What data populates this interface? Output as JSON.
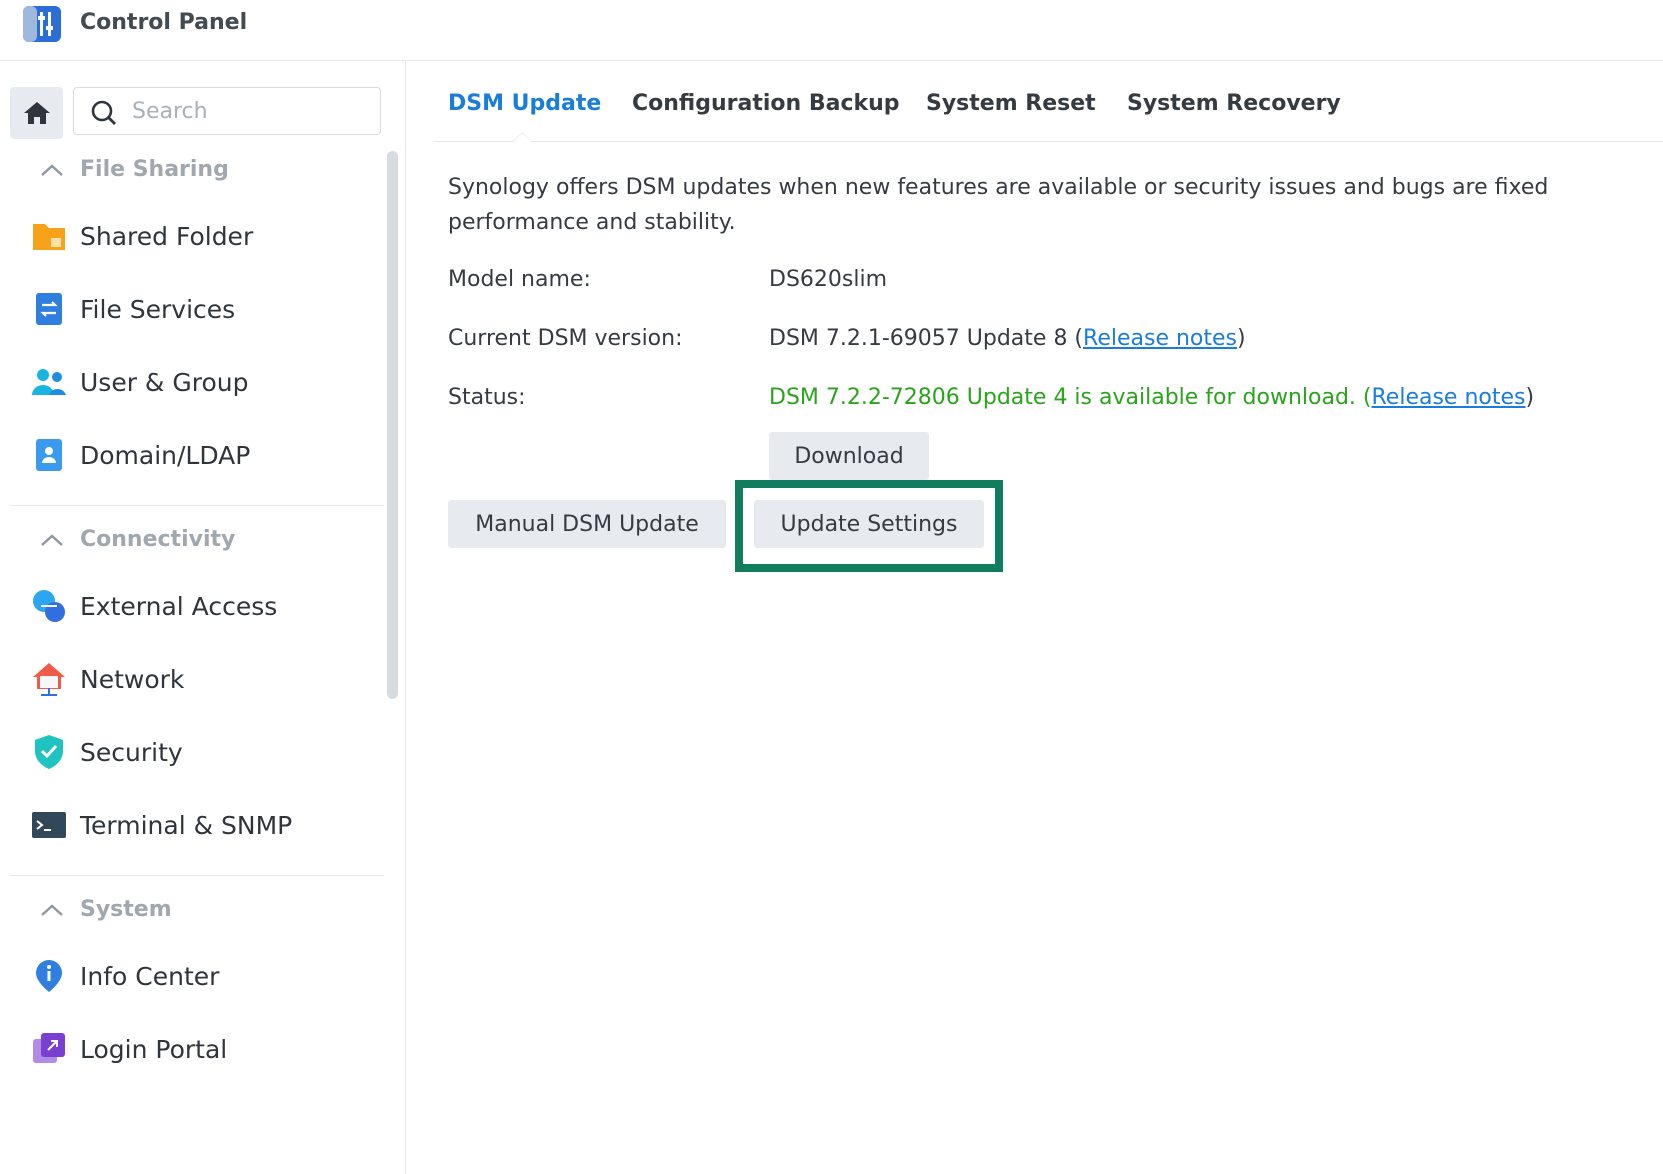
{
  "app": {
    "title": "Control Panel",
    "icon": "control-panel-icon"
  },
  "search": {
    "placeholder": "Search"
  },
  "sidebar": {
    "sections": [
      {
        "title": "File Sharing",
        "items": [
          {
            "label": "Shared Folder",
            "icon": "shared-folder-icon"
          },
          {
            "label": "File Services",
            "icon": "file-services-icon"
          },
          {
            "label": "User & Group",
            "icon": "user-group-icon"
          },
          {
            "label": "Domain/LDAP",
            "icon": "domain-ldap-icon"
          }
        ]
      },
      {
        "title": "Connectivity",
        "items": [
          {
            "label": "External Access",
            "icon": "external-access-icon"
          },
          {
            "label": "Network",
            "icon": "network-icon"
          },
          {
            "label": "Security",
            "icon": "security-shield-icon"
          },
          {
            "label": "Terminal & SNMP",
            "icon": "terminal-icon"
          }
        ]
      },
      {
        "title": "System",
        "items": [
          {
            "label": "Info Center",
            "icon": "info-center-icon"
          },
          {
            "label": "Login Portal",
            "icon": "login-portal-icon"
          }
        ]
      }
    ]
  },
  "tabs": [
    {
      "label": "DSM Update",
      "active": true
    },
    {
      "label": "Configuration Backup",
      "active": false
    },
    {
      "label": "System Reset",
      "active": false
    },
    {
      "label": "System Recovery",
      "active": false
    }
  ],
  "main": {
    "description_line1": "Synology offers DSM updates when new features are available or security issues and bugs are fixed",
    "description_line2": "performance and stability.",
    "model_label": "Model name:",
    "model_value": "DS620slim",
    "version_label": "Current DSM version:",
    "version_value": "DSM 7.2.1-69057 Update 8 (",
    "version_link": "Release notes",
    "version_close": ")",
    "status_label": "Status:",
    "status_value": "DSM 7.2.2-72806 Update 4 is available for download. (",
    "status_link": "Release notes",
    "status_close": ")",
    "download_button": "Download",
    "manual_update_button": "Manual DSM Update",
    "update_settings_button": "Update Settings"
  },
  "colors": {
    "accent": "#1a7ddb",
    "status_green": "#2aa41b",
    "highlight_border": "#0f7d5e"
  }
}
